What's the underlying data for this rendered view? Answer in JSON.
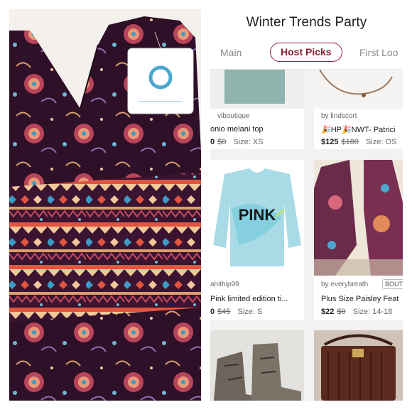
{
  "app": {
    "title": "Winter Trends Party",
    "tabs": [
      {
        "label": "Main",
        "active": false
      },
      {
        "label": "Host Picks",
        "active": true
      },
      {
        "label": "First Loo",
        "active": false
      }
    ],
    "accent_color": "#8a2133"
  },
  "listings": [
    {
      "seller": "viboutique",
      "title": "onio melani top",
      "price": "0",
      "original_price": "$0",
      "size": "Size: XS"
    },
    {
      "seller": "by lindscort",
      "title": "🎉HP🎉NWT- Patrici",
      "price": "$125",
      "original_price": "$180",
      "size": "Size: OS"
    },
    {
      "seller": "ahithip99",
      "title": "Pink limited edition ti...",
      "price": "0",
      "original_price": "$45",
      "size": "Size: S",
      "image_text": "PINK"
    },
    {
      "seller": "by everybreath",
      "badge": "BOUT",
      "title": "Plus Size Paisley Feat",
      "price": "$22",
      "original_price": "$0",
      "size": "Size: 14-18"
    }
  ]
}
